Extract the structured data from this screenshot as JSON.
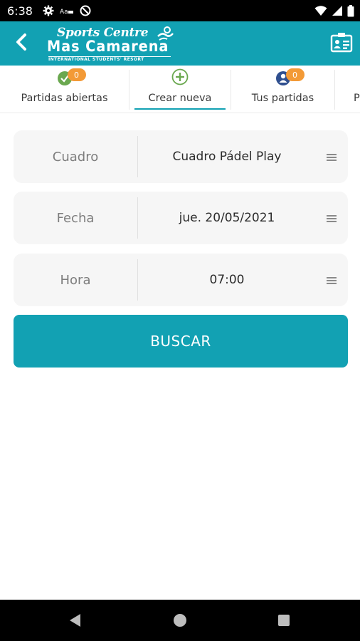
{
  "status_bar": {
    "time": "6:38",
    "icons_left": [
      "gear-icon",
      "sim-icon",
      "data-saver-icon"
    ],
    "icons_right": [
      "wifi-icon",
      "signal-icon",
      "battery-icon"
    ]
  },
  "app_bar": {
    "logo": {
      "line1": "Sports Centre",
      "line2": "Mas Camarena",
      "line3": "INTERNATIONAL STUDENTS' RESORT"
    },
    "back_icon": "chevron-left-icon",
    "card_icon": "id-card-icon"
  },
  "tabs": [
    {
      "label": "Partidas abiertas",
      "icon": "check-circle-icon",
      "badge": "0",
      "icon_color": "#6aa84f"
    },
    {
      "label": "Crear nueva",
      "icon": "plus-circle-icon",
      "active": true,
      "icon_color": "#6aa84f"
    },
    {
      "label": "Tus partidas",
      "icon": "user-circle-icon",
      "badge": "0",
      "icon_color": "#2f4f8f"
    },
    {
      "label": "P"
    }
  ],
  "form": {
    "rows": [
      {
        "label": "Cuadro",
        "value": "Cuadro Pádel Play"
      },
      {
        "label": "Fecha",
        "value": "jue. 20/05/2021"
      },
      {
        "label": "Hora",
        "value": "07:00"
      }
    ],
    "search_label": "BUSCAR"
  },
  "nav_bar": {
    "buttons": [
      "back-triangle-icon",
      "home-circle-icon",
      "recents-square-icon"
    ]
  },
  "colors": {
    "accent": "#12a1b3",
    "badge": "#f39a36"
  }
}
